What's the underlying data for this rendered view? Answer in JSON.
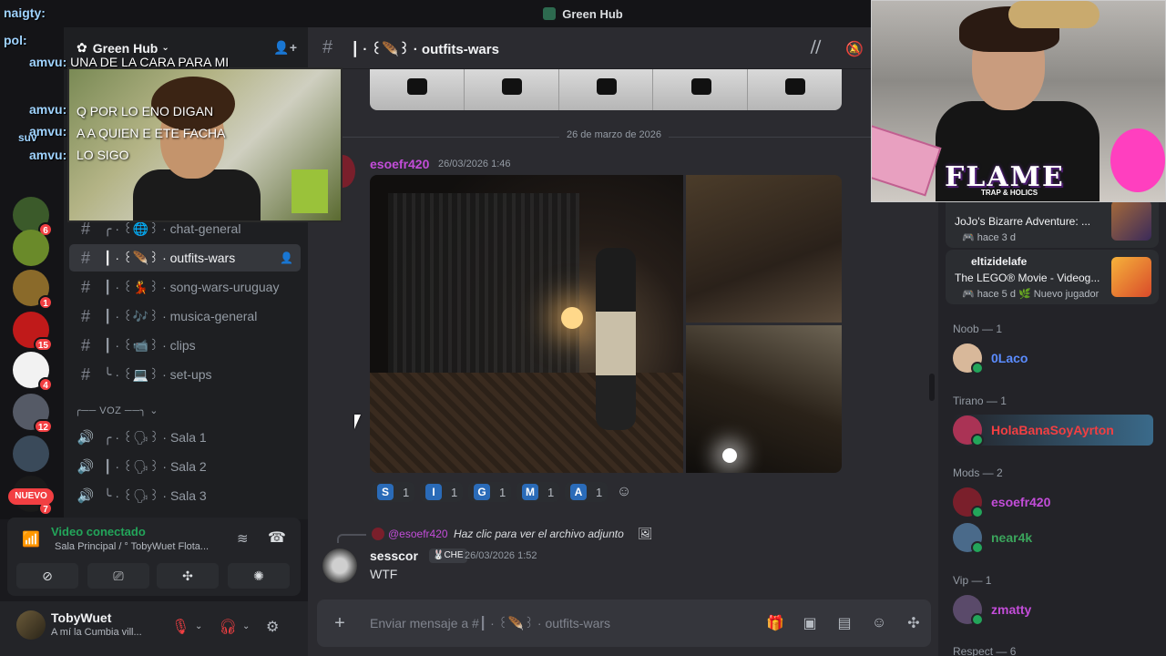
{
  "window": {
    "title": "Green Hub"
  },
  "server": {
    "name": "Green Hub"
  },
  "channels": [
    {
      "label": "╭ · ꒰🌐꒱ · chat-general",
      "active": false
    },
    {
      "label": "┃ · ꒰🪶꒱ · outfits-wars",
      "active": true
    },
    {
      "label": "┃ · ꒰💃꒱ · song-wars-uruguay",
      "active": false
    },
    {
      "label": "┃ · ꒰🎶꒱ · musica-general",
      "active": false
    },
    {
      "label": "┃ · ꒰📹꒱ · clips",
      "active": false
    },
    {
      "label": "╰ · ꒰💻꒱ · set-ups",
      "active": false
    }
  ],
  "voice_category": "╭── VOZ ──╮ ⌄",
  "voice_channels": [
    "╭ · ꒰🗣꒱ · Sala 1",
    "┃ · ꒰🗣꒱ · Sala 2",
    "╰ · ꒰🗣꒱ · Sala 3"
  ],
  "guild_badges": [
    "6",
    "1",
    "15",
    "4",
    "12",
    "7"
  ],
  "nuevo_label": "NUEVO",
  "voice_panel": {
    "status": "Video conectado",
    "location": "Sala Principal / ° TobyWuet Flota..."
  },
  "user": {
    "name": "TobyWuet",
    "status": "A mí la Cumbia vill..."
  },
  "channel_header": {
    "name": "┃ · ꒰🪶꒱ · outfits-wars"
  },
  "date_divider": "26 de marzo de 2026",
  "message1": {
    "author": "esoefr420",
    "time": "26/03/2026 1:46"
  },
  "reactions": [
    {
      "letter": "S",
      "count": "1"
    },
    {
      "letter": "I",
      "count": "1"
    },
    {
      "letter": "G",
      "count": "1"
    },
    {
      "letter": "M",
      "count": "1"
    },
    {
      "letter": "A",
      "count": "1"
    }
  ],
  "reply": {
    "author": "@esoefr420",
    "text": "Haz clic para ver el archivo adjunto"
  },
  "message2": {
    "author": "sesscor",
    "tag": "🐰CHE",
    "time": "26/03/2026 1:52",
    "text": "WTF"
  },
  "composer": {
    "placeholder": "Enviar mensaje a #┃ · ꒰🪶꒱ · outfits-wars"
  },
  "members": {
    "activity_cards": [
      {
        "name": "",
        "game": "JoJo's Bizarre Adventure: ...",
        "ago": "🎮 hace 3 d"
      },
      {
        "name": "eltizidelafe",
        "game": "The LEGO® Movie - Videog...",
        "ago": "🎮 hace 5 d  🌿 Nuevo jugador"
      }
    ],
    "groups": [
      {
        "role": "Noob — 1",
        "members": [
          {
            "name": "0Laco",
            "color": "#5b8cff"
          }
        ]
      },
      {
        "role": "Tirano — 1",
        "members": [
          {
            "name": "HolaBanaSoyAyrton",
            "color": "#f23f42"
          }
        ]
      },
      {
        "role": "Mods — 2",
        "members": [
          {
            "name": "esoefr420",
            "color": "#c34dd9"
          },
          {
            "name": "near4k",
            "color": "#3ba55c"
          }
        ]
      },
      {
        "role": "Vip — 1",
        "members": [
          {
            "name": "zmatty",
            "color": "#c34dd9"
          }
        ]
      },
      {
        "role": "Respect — 6",
        "members": []
      }
    ]
  },
  "webcam": {
    "brand": "FLAME",
    "sub": "TRAP & HOLICS"
  },
  "cam_overlay_lines": [
    "Q POR LO ENO DIGAN",
    "A A QUIEN E ETE FACHA",
    "LO SIGO"
  ],
  "chat_overlay": [
    {
      "user": "naigty:",
      "text": ""
    },
    {
      "user": "pol:",
      "text": ""
    },
    {
      "user": "amvu:",
      "text": "UNA DE LA CARA PARA MI"
    },
    {
      "user": "amvu:",
      "text": "Q POR LO ENO DIGAN"
    },
    {
      "user": "amvu:",
      "text": "A A QUIEN E ETE FACHA"
    },
    {
      "user": "amvu:",
      "text": "LO SIGO"
    },
    {
      "user": "suv",
      "text": ""
    }
  ]
}
